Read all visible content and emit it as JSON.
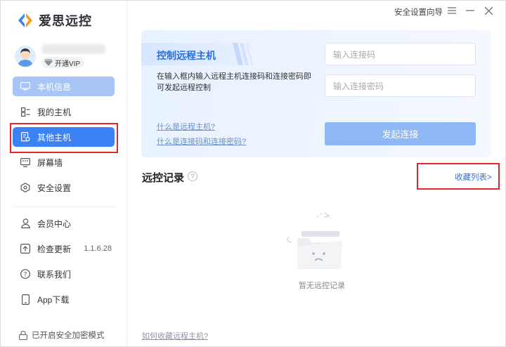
{
  "app": {
    "name": "爱思远控"
  },
  "user": {
    "vip_label": "开通VIP"
  },
  "sidebar": {
    "items": [
      {
        "label": "本机信息",
        "icon": "monitor-icon"
      },
      {
        "label": "我的主机",
        "icon": "hosts-icon"
      },
      {
        "label": "其他主机",
        "icon": "other-host-icon"
      },
      {
        "label": "屏幕墙",
        "icon": "screen-wall-icon"
      },
      {
        "label": "安全设置",
        "icon": "shield-icon"
      }
    ],
    "lower": [
      {
        "label": "会员中心",
        "icon": "user-icon"
      },
      {
        "label": "检查更新",
        "icon": "update-icon",
        "version": "1.1.6.28"
      },
      {
        "label": "联系我们",
        "icon": "help-icon"
      },
      {
        "label": "App下载",
        "icon": "phone-icon"
      }
    ],
    "footer": "已开启安全加密模式"
  },
  "titlebar": {
    "guide": "安全设置向导"
  },
  "connect": {
    "title": "控制远程主机",
    "description": "在输入框内输入远程主机连接码和连接密码即可发起远程控制",
    "link_what_host": "什么是远程主机?",
    "link_what_code": "什么是连接码和连接密码?",
    "code_placeholder": "输入连接码",
    "password_placeholder": "输入连接密码",
    "button": "发起连接"
  },
  "records": {
    "title": "远控记录",
    "help": "?",
    "favorites_link": "收藏列表>",
    "empty_text": "暂无远控记录",
    "bottom_link": "如何收藏远程主机?"
  },
  "colors": {
    "accent": "#3b82f5",
    "highlight": "#e5242b"
  }
}
